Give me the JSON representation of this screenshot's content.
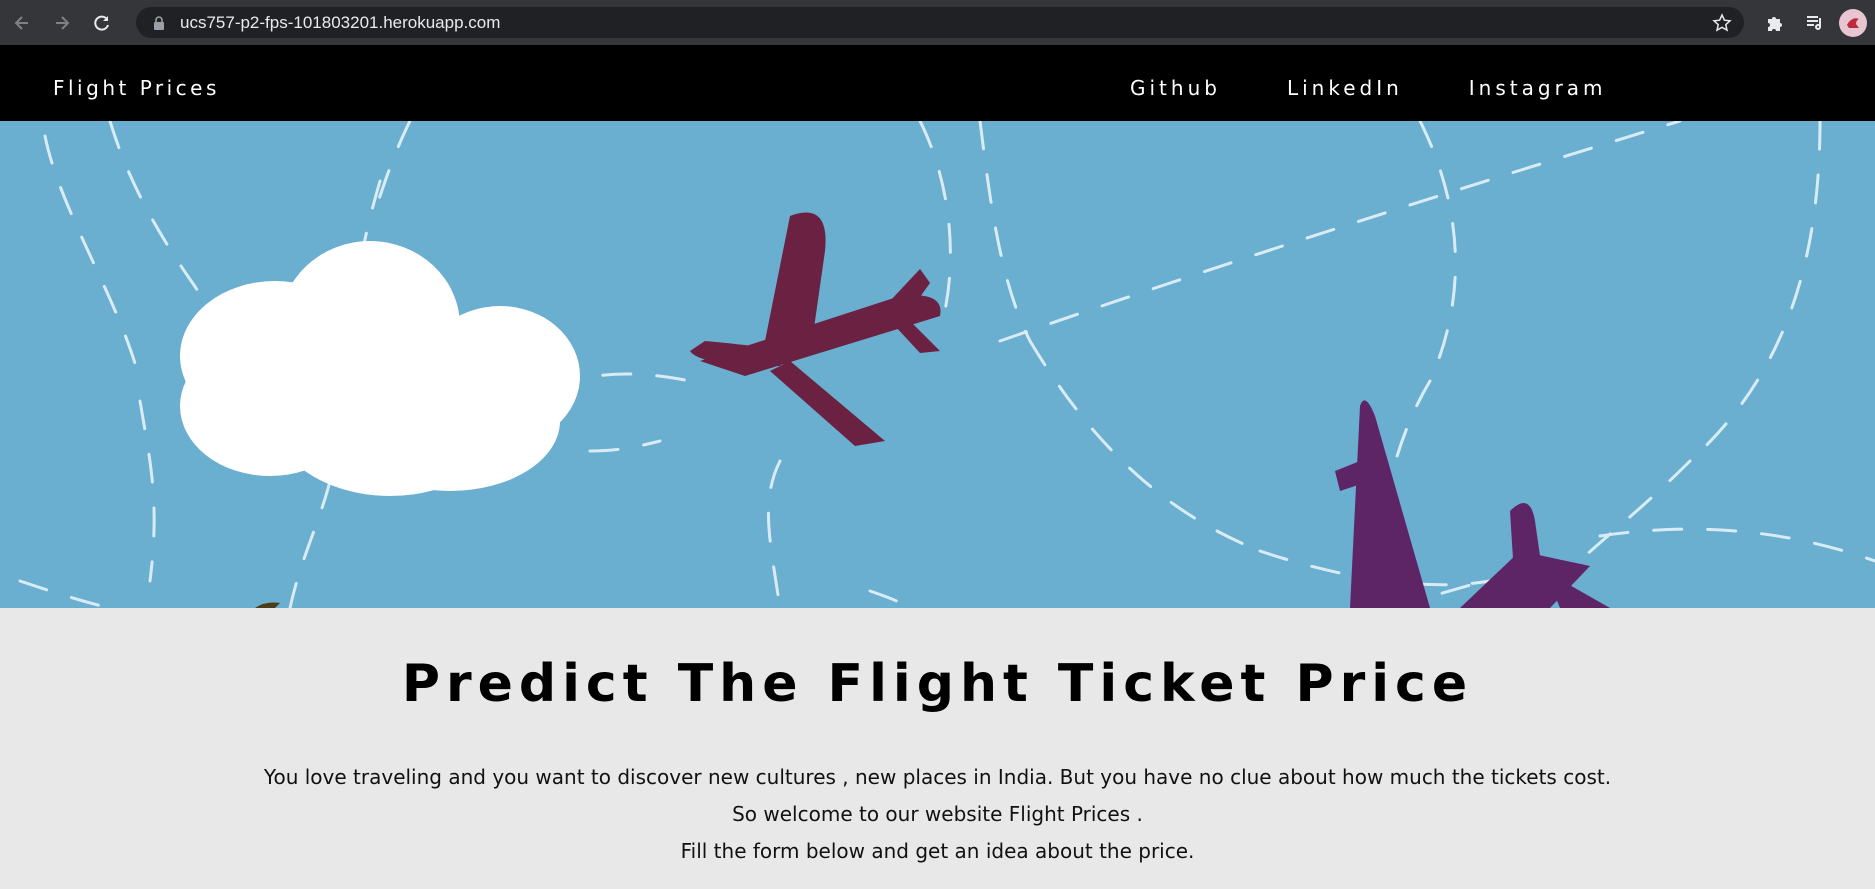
{
  "browser": {
    "url": "ucs757-p2-fps-101803201.herokuapp.com",
    "back_icon": "arrow-left-icon",
    "forward_icon": "arrow-right-icon",
    "reload_icon": "reload-icon",
    "lock_icon": "lock-icon",
    "bookmark_icon": "star-icon",
    "extensions_icon": "puzzle-icon",
    "media_icon": "media-queue-icon",
    "profile_icon": "avatar"
  },
  "site_nav": {
    "brand": "Flight Prices",
    "links": [
      "Github",
      "LinkedIn",
      "Instagram"
    ]
  },
  "hero": {
    "background": "#6aaed0",
    "plane_colors": [
      "#6b2142",
      "#5e2566"
    ],
    "cloud_color": "#ffffff"
  },
  "main": {
    "headline": "Predict The Flight Ticket Price",
    "paragraphs": [
      "You love traveling and you want to discover new cultures , new places in India. But you have no clue about how much the tickets cost.",
      "So welcome to our website Flight Prices .",
      "Fill the form below and get an idea about the price."
    ]
  }
}
